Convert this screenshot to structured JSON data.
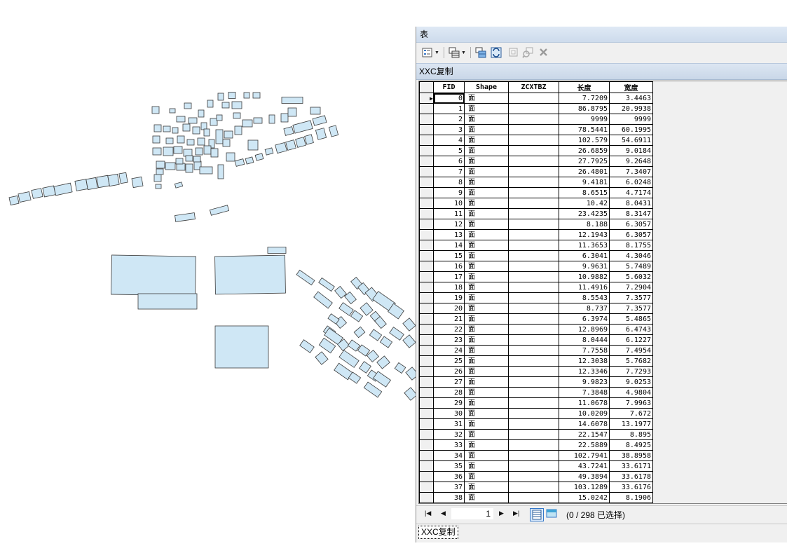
{
  "window": {
    "title": "表"
  },
  "table_tab": {
    "caption": "XXC复制"
  },
  "toolbar": {
    "icons": [
      "table-options-icon",
      "related-tables-icon",
      "select-by-attributes-icon",
      "switch-selection-icon",
      "clear-selection-icon",
      "zoom-to-selected-icon",
      "delete-selected-icon"
    ]
  },
  "columns": [
    "FID",
    "Shape",
    "ZCXTBZ",
    "长度",
    "宽度"
  ],
  "rows": [
    [
      "0",
      "面",
      "",
      "7.7209",
      "3.4463"
    ],
    [
      "1",
      "面",
      "",
      "86.8795",
      "20.9938"
    ],
    [
      "2",
      "面",
      "",
      "9999",
      "9999"
    ],
    [
      "3",
      "面",
      "",
      "78.5441",
      "60.1995"
    ],
    [
      "4",
      "面",
      "",
      "102.579",
      "54.6911"
    ],
    [
      "5",
      "面",
      "",
      "26.6859",
      "9.0184"
    ],
    [
      "6",
      "面",
      "",
      "27.7925",
      "9.2648"
    ],
    [
      "7",
      "面",
      "",
      "26.4801",
      "7.3407"
    ],
    [
      "8",
      "面",
      "",
      "9.4181",
      "6.0248"
    ],
    [
      "9",
      "面",
      "",
      "8.6515",
      "4.7174"
    ],
    [
      "10",
      "面",
      "",
      "10.42",
      "8.0431"
    ],
    [
      "11",
      "面",
      "",
      "23.4235",
      "8.3147"
    ],
    [
      "12",
      "面",
      "",
      "8.188",
      "6.3057"
    ],
    [
      "13",
      "面",
      "",
      "12.1943",
      "6.3057"
    ],
    [
      "14",
      "面",
      "",
      "11.3653",
      "8.1755"
    ],
    [
      "15",
      "面",
      "",
      "6.3041",
      "4.3046"
    ],
    [
      "16",
      "面",
      "",
      "9.9631",
      "5.7489"
    ],
    [
      "17",
      "面",
      "",
      "10.9882",
      "5.6032"
    ],
    [
      "18",
      "面",
      "",
      "11.4916",
      "7.2904"
    ],
    [
      "19",
      "面",
      "",
      "8.5543",
      "7.3577"
    ],
    [
      "20",
      "面",
      "",
      "8.737",
      "7.3577"
    ],
    [
      "21",
      "面",
      "",
      "6.3974",
      "5.4865"
    ],
    [
      "22",
      "面",
      "",
      "12.8969",
      "6.4743"
    ],
    [
      "23",
      "面",
      "",
      "8.0444",
      "6.1227"
    ],
    [
      "24",
      "面",
      "",
      "7.7558",
      "7.4954"
    ],
    [
      "25",
      "面",
      "",
      "12.3038",
      "5.7682"
    ],
    [
      "26",
      "面",
      "",
      "12.3346",
      "7.7293"
    ],
    [
      "27",
      "面",
      "",
      "9.9823",
      "9.0253"
    ],
    [
      "28",
      "面",
      "",
      "7.3848",
      "4.9804"
    ],
    [
      "29",
      "面",
      "",
      "11.0678",
      "7.9963"
    ],
    [
      "30",
      "面",
      "",
      "10.0209",
      "7.672"
    ],
    [
      "31",
      "面",
      "",
      "14.6078",
      "13.1977"
    ],
    [
      "32",
      "面",
      "",
      "22.1547",
      "8.895"
    ],
    [
      "33",
      "面",
      "",
      "22.5889",
      "8.4925"
    ],
    [
      "34",
      "面",
      "",
      "102.7941",
      "38.8958"
    ],
    [
      "35",
      "面",
      "",
      "43.7241",
      "33.6171"
    ],
    [
      "36",
      "面",
      "",
      "49.3894",
      "33.6178"
    ],
    [
      "37",
      "面",
      "",
      "103.1289",
      "33.6176"
    ],
    [
      "38",
      "面",
      "",
      "15.0242",
      "8.1906"
    ]
  ],
  "navigation": {
    "current_record": "1",
    "selection_status": "(0 / 298 已选择)"
  },
  "bottom_tab": {
    "label": "XXC复制"
  },
  "colors": {
    "polygon_fill": "#cfe7f5",
    "polygon_stroke": "#3c3c3c",
    "title_bar": "#cddbec",
    "window_bg": "#f0f0f0"
  }
}
